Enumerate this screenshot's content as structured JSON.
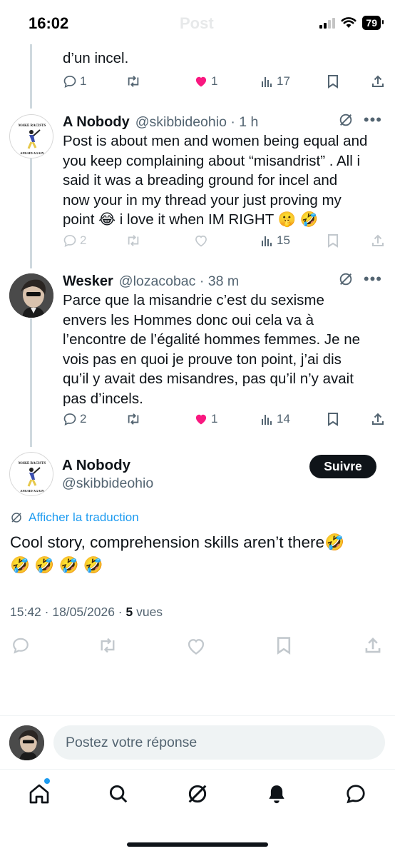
{
  "status_bar": {
    "time": "16:02",
    "battery": "79",
    "ghost_title": "Post"
  },
  "thread": [
    {
      "text_lines": [
        "d’un incel."
      ],
      "actions": {
        "replies": "1",
        "retweets": "",
        "likes": "1",
        "views": "17"
      }
    },
    {
      "author_name": "A Nobody",
      "author_handle": "@skibbideohio · 1 h",
      "text_lines": [
        "Post is about men and women being equal and",
        "you keep complaining about “misandrist” . All i",
        "said it was a breading ground for incel and",
        "now your in my thread your just proving my",
        "point 😂 i love it when IM RIGHT 🤫 🤣"
      ],
      "actions": {
        "replies": "2",
        "retweets": "",
        "likes": "",
        "views": "15"
      }
    },
    {
      "author_name": "Wesker",
      "author_handle": "@lozacobac · 38 m",
      "text_lines": [
        "Parce que la misandrie c’est du sexisme",
        "envers les Hommes donc oui cela va à",
        "l’encontre de l’égalité hommes femmes. Je ne",
        "vois pas en quoi je prouve ton point, j’ai dis",
        "qu’il y avait des misandres, pas qu’il n’y avait",
        "pas d’incels."
      ],
      "actions": {
        "replies": "2",
        "retweets": "",
        "likes": "1",
        "views": "14"
      }
    }
  ],
  "main_tweet": {
    "author_name": "A Nobody",
    "author_handle": "@skibbideohio",
    "follow_label": "Suivre",
    "translate_label": "Afficher la traduction",
    "text_lines": [
      "Cool story, comprehension skills aren’t there🤣",
      "🤣 🤣 🤣 🤣"
    ],
    "timestamp": "15:42 · 18/05/2026 · ",
    "views_count": "5",
    "views_label": " vues"
  },
  "avatar_text": {
    "nobody_top": "MAKE RACISTS",
    "nobody_bottom": "AFRAID AGAIN"
  },
  "reply_bar": {
    "placeholder": "Postez votre réponse"
  },
  "tab_bar": {
    "tabs": [
      "home-icon",
      "search-icon",
      "grok-icon",
      "notifications-icon",
      "messages-icon"
    ]
  },
  "colors": {
    "like": "#f91880",
    "link": "#1d9bf0",
    "muted": "#536471",
    "text": "#0f1419"
  }
}
